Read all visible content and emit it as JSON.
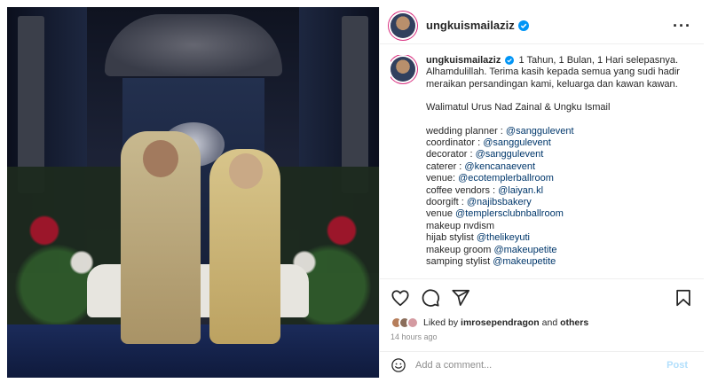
{
  "post": {
    "username": "ungkuismailaziz",
    "verified": true,
    "more_icon": "more-horizontal-icon",
    "caption": {
      "lines": [
        "1 Tahun, 1 Bulan, 1 Hari selepasnya.",
        "Alhamdulillah. Terima kasih kepada semua yang sudi hadir",
        "meraikan persandingan kami, keluarga dan kawan kawan.",
        "",
        "Walimatul Urus Nad Zainal & Ungku Ismail",
        ""
      ],
      "credits": [
        {
          "label": "wedding planner : ",
          "mention": "@sanggulevent"
        },
        {
          "label": "coordinator : ",
          "mention": "@sanggulevent"
        },
        {
          "label": "decorator : ",
          "mention": "@sanggulevent"
        },
        {
          "label": "caterer : ",
          "mention": "@kencanaevent"
        },
        {
          "label": "venue: ",
          "mention": "@ecotemplerballroom"
        },
        {
          "label": "coffee vendors : ",
          "mention": "@laiyan.kl"
        },
        {
          "label": "doorgift : ",
          "mention": "@najibsbakery"
        },
        {
          "label": "venue ",
          "mention": "@templersclubnballroom"
        },
        {
          "label": "makeup nvdism",
          "mention": ""
        },
        {
          "label": "hijab stylist ",
          "mention": "@thelikeyuti"
        },
        {
          "label": "makeup groom ",
          "mention": "@makeupetite"
        },
        {
          "label": "samping stylist ",
          "mention": "@makeupetite"
        }
      ]
    },
    "likes": {
      "prefix": "Liked by ",
      "user": "imrosependragon",
      "middle": " and ",
      "others": "others"
    },
    "timestamp": "14 hours ago",
    "comment": {
      "placeholder": "Add a comment...",
      "post_label": "Post"
    },
    "colors": {
      "link": "#00376b",
      "verified": "#0095f6",
      "post_button_disabled": "#b2dffc"
    }
  }
}
